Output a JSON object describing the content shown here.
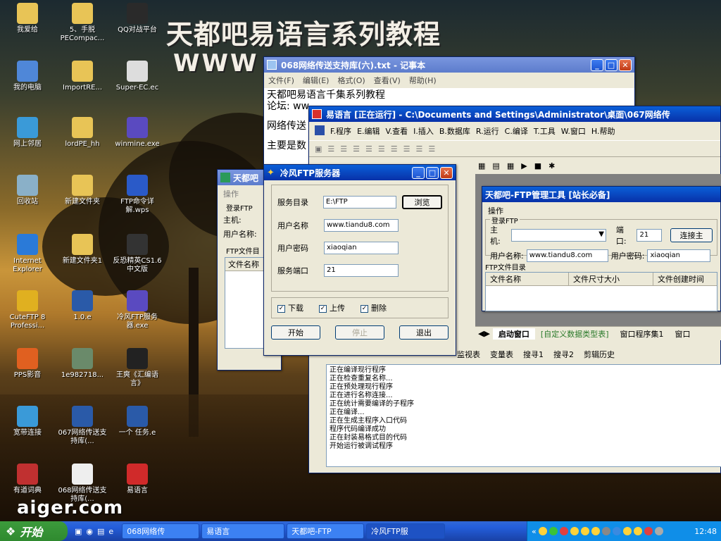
{
  "banner": {
    "title": "天都吧易语言系列教程",
    "url": "WWW"
  },
  "watermark": "aiger.com",
  "desktop_icons": [
    {
      "label": "我爱给",
      "icon": "folder-icon"
    },
    {
      "label": "5、手脱PECompac...",
      "icon": "folder-icon"
    },
    {
      "label": "QQ对战平台",
      "icon": "qq-icon"
    },
    {
      "label": "我的电脑",
      "icon": "computer-icon"
    },
    {
      "label": "ImportRE...",
      "icon": "folder-icon"
    },
    {
      "label": "Super-EC.ec",
      "icon": "file-icon"
    },
    {
      "label": "网上邻居",
      "icon": "network-icon"
    },
    {
      "label": "lordPE_hh",
      "icon": "folder-icon"
    },
    {
      "label": "winmine.exe",
      "icon": "mine-icon"
    },
    {
      "label": "回收站",
      "icon": "recycle-bin-icon"
    },
    {
      "label": "新建文件夹",
      "icon": "folder-icon"
    },
    {
      "label": "FTP命令详解.wps",
      "icon": "wps-icon"
    },
    {
      "label": "Internet Explorer",
      "icon": "ie-icon"
    },
    {
      "label": "新建文件夹1",
      "icon": "folder-icon"
    },
    {
      "label": "反恐精英CS1.6中文版",
      "icon": "cs-icon"
    },
    {
      "label": "CuteFTP 8 Professi...",
      "icon": "cuteftp-icon"
    },
    {
      "label": "1.0.e",
      "icon": "e-file-icon"
    },
    {
      "label": "冷风FTP服务器.exe",
      "icon": "mine-icon"
    },
    {
      "label": "PPS影音",
      "icon": "pps-icon"
    },
    {
      "label": "1e982718...",
      "icon": "image-icon"
    },
    {
      "label": "王爽《汇编语言》",
      "icon": "help-icon"
    },
    {
      "label": "宽带连接",
      "icon": "network-icon"
    },
    {
      "label": "067网络传送支持库(...",
      "icon": "e-file-icon"
    },
    {
      "label": "一个 任务.e",
      "icon": "e-file-icon"
    },
    {
      "label": "有道词典",
      "icon": "dict-icon"
    },
    {
      "label": "068网络传送支持库(...",
      "icon": "text-file-icon"
    },
    {
      "label": "易语言",
      "icon": "e-lang-icon"
    }
  ],
  "notepad": {
    "title": "068网络传送支持库(六).txt - 记事本",
    "menu": [
      "文件(F)",
      "编辑(E)",
      "格式(O)",
      "查看(V)",
      "帮助(H)"
    ],
    "lines": [
      "天都吧易语言千集系列教程",
      "论坛: ww",
      "网络传送",
      "主要是数"
    ]
  },
  "eide": {
    "title": "易语言 [正在运行] - C:\\Documents and Settings\\Administrator\\桌面\\067网络传",
    "menu": [
      "F.程序",
      "E.编辑",
      "V.查看",
      "I.插入",
      "B.数据库",
      "R.运行",
      "C.编译",
      "T.工具",
      "W.窗口",
      "H.帮助"
    ],
    "tabs": [
      "启动窗口",
      "[自定义数据类型表]",
      "窗口程序集1",
      "窗口"
    ],
    "bottom_tabs": [
      "监视表",
      "变量表",
      "搜寻1",
      "搜寻2",
      "剪辑历史"
    ],
    "output": [
      "正在编译现行程序",
      "正在检查重复名称...",
      "正在预处理现行程序",
      "正在进行名称连接...",
      "正在统计需要编译的子程序",
      "正在编译...",
      "正在生成主程序入口代码",
      "程序代码编译成功",
      "正在封装易格式目的代码",
      "开始运行被调试程序"
    ]
  },
  "ftp_tool": {
    "title": "天都吧-FTP管理工具 [站长必备]",
    "menu": "操作",
    "group_login": "登录FTP",
    "host_label": "主机:",
    "port_label": "端口:",
    "port": "21",
    "connect_label": "连接主",
    "user_label": "用户名称:",
    "user": "www.tiandu8.com",
    "pass_label": "用户密码:",
    "pass": "xiaoqian",
    "group_dir": "FTP文件目录",
    "columns": [
      "文件名称",
      "文件尺寸大小",
      "文件创建时间"
    ]
  },
  "back_ftp": {
    "title": "天都吧",
    "menu": "操作",
    "group_login": "登录FTP",
    "host_label": "主机:",
    "user_label": "用户名称:",
    "group_dir": "FTP文件目",
    "col": "文件名称"
  },
  "lengfeng": {
    "title": "冷风FTP服务器",
    "dir_label": "服务目录",
    "dir": "E:\\FTP",
    "browse": "浏览",
    "user_label": "用户名称",
    "user": "www.tiandu8.com",
    "pass_label": "用户密码",
    "pass": "xiaoqian",
    "port_label": "服务端口",
    "port": "21",
    "chk_download": "下载",
    "chk_upload": "上传",
    "chk_delete": "删除",
    "start": "开始",
    "stop": "停止",
    "exit": "退出"
  },
  "taskbar": {
    "start": "开始",
    "tasks": [
      "068网络传",
      "易语言",
      "天都吧-FTP",
      "冷风FTP服"
    ],
    "clock": "12:48"
  }
}
